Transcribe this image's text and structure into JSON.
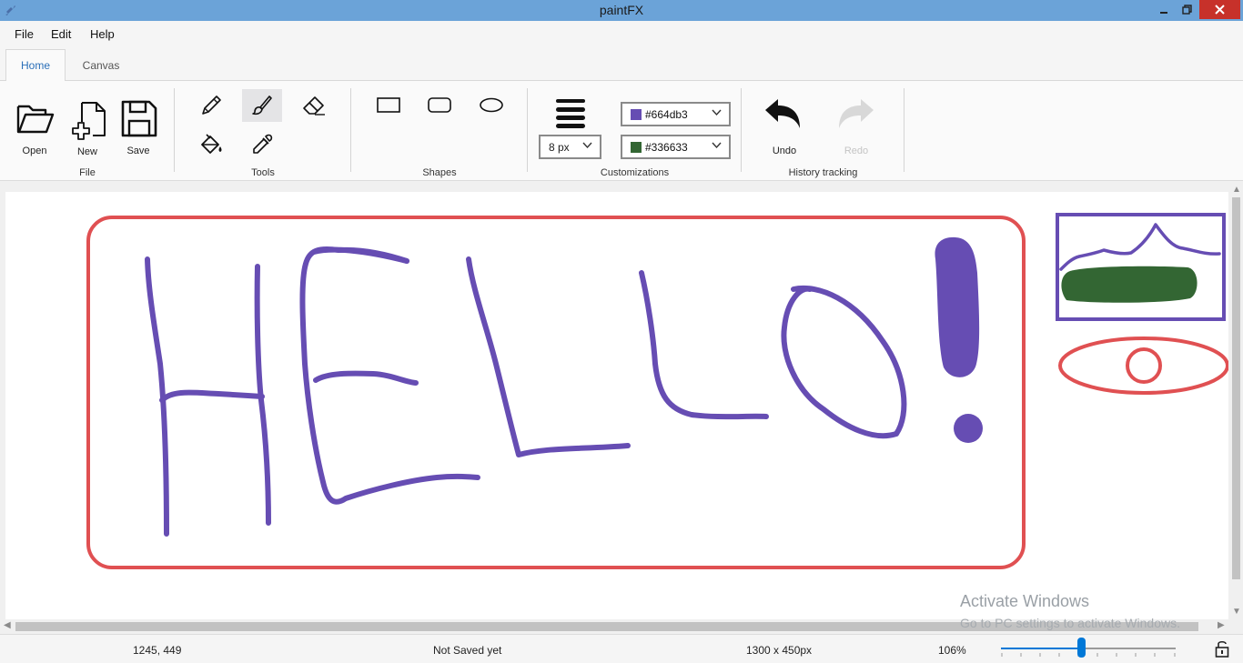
{
  "window": {
    "title": "paintFX",
    "controls": {
      "minimize": "▁",
      "maximize": "❐",
      "close": "✕"
    }
  },
  "menu": [
    {
      "label": "File"
    },
    {
      "label": "Edit"
    },
    {
      "label": "Help"
    }
  ],
  "tabs": [
    {
      "label": "Home",
      "active": true
    },
    {
      "label": "Canvas",
      "active": false
    }
  ],
  "ribbon": {
    "file_group": {
      "label": "File",
      "open_label": "Open",
      "new_label": "New",
      "save_label": "Save"
    },
    "tools_group": {
      "label": "Tools",
      "tools": [
        "pencil",
        "brush",
        "eraser",
        "fill-bucket",
        "color-picker"
      ],
      "active_tool": "brush"
    },
    "shapes_group": {
      "label": "Shapes",
      "shapes": [
        "rectangle",
        "rounded-rectangle",
        "ellipse"
      ]
    },
    "customizations_group": {
      "label": "Customizations",
      "stroke_size": "8 px",
      "primary_color": "#664db3",
      "secondary_color": "#336633"
    },
    "history_group": {
      "label": "History tracking",
      "undo_label": "Undo",
      "redo_label": "Redo",
      "redo_enabled": false
    }
  },
  "canvas": {
    "background": "#ffffff",
    "drawing_colors": {
      "purple": "#664db3",
      "red": "#e05052",
      "green": "#336633"
    }
  },
  "watermark": {
    "title": "Activate Windows",
    "subtitle": "Go to PC settings to activate Windows."
  },
  "status": {
    "cursor_position": "1245, 449",
    "save_state": "Not Saved yet",
    "canvas_size": "1300 x 450px",
    "zoom": "106%",
    "zoom_slider_fraction": 0.46
  },
  "colors": {
    "titlebar": "#6ba3d8",
    "accent": "#0078d7",
    "close": "#c7312a"
  }
}
